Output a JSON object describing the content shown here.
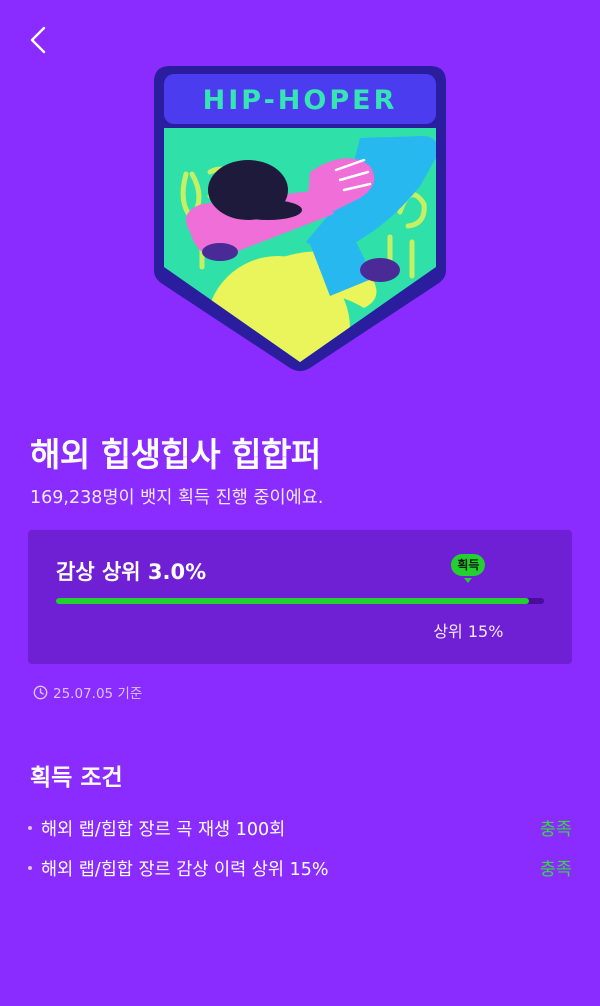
{
  "header": {
    "back_icon": "chevron-left-icon"
  },
  "badge": {
    "banner_text": "HIP-HOPER",
    "colors": {
      "frame": "#2a1d9e",
      "banner": "#4b3cf0",
      "banner_text": "#35e6b4",
      "field": "#2fe0a8"
    }
  },
  "title": "해외 힙생힙사 힙합퍼",
  "subtitle": "169,238명이 뱃지 획득 진행 중이에요.",
  "rank": {
    "label": "감상 상위 3.0%",
    "progress": 0.97,
    "marker_position": 0.845,
    "marker_label": "획득",
    "marker_sub": "상위 15%",
    "colors": {
      "fill": "#22d02f",
      "track": "#4a0d9b"
    }
  },
  "basis": {
    "icon": "clock-icon",
    "text": "25.07.05 기준"
  },
  "conditions": {
    "title": "획득 조건",
    "items": [
      {
        "text": "해외 랩/힙합 장르 곡 재생 100회",
        "status": "충족"
      },
      {
        "text": "해외 랩/힙합 장르 감상 이력 상위 15%",
        "status": "충족"
      }
    ]
  },
  "colors": {
    "background": "#8a2cff",
    "card": "#6f1fd4",
    "status": "#35d83f"
  }
}
